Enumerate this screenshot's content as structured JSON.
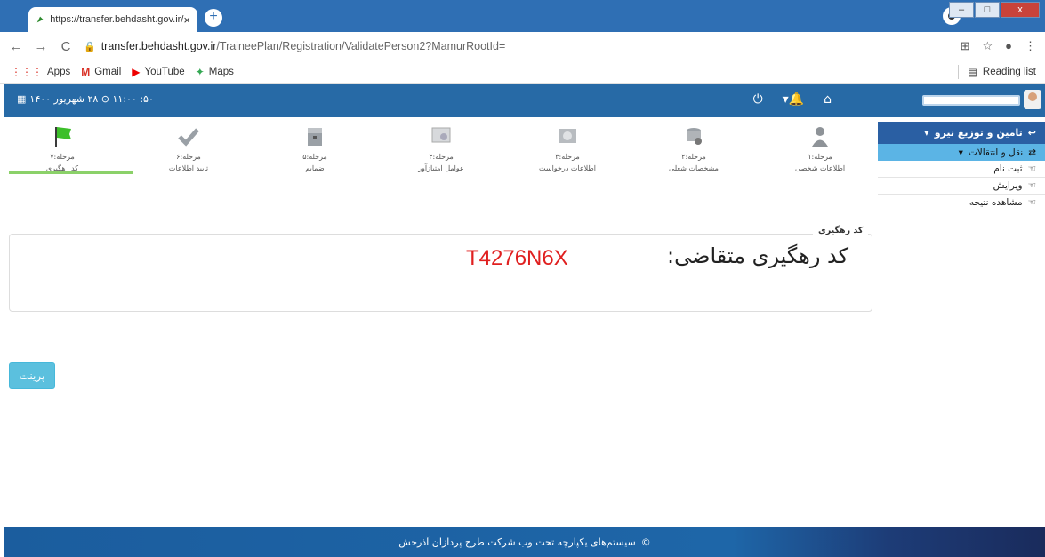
{
  "browser": {
    "tab_title": "https://transfer.behdasht.gov.ir/",
    "tab_close": "×",
    "new_tab": "+",
    "url_domain": "transfer.behdasht.gov.ir",
    "url_path": "/TraineePlan/Registration/ValidatePerson2?MamurRootId=",
    "bookmarks": [
      {
        "label": "Apps",
        "icon": "apps-grid-icon"
      },
      {
        "label": "Gmail",
        "icon": "gmail-icon"
      },
      {
        "label": "YouTube",
        "icon": "youtube-icon"
      },
      {
        "label": "Maps",
        "icon": "maps-icon"
      }
    ],
    "reading_list": "Reading list"
  },
  "header": {
    "datetime": "۵۰: ۱۱:۰۰ ⊙ ۲۸ شهریور ۱۴۰۰"
  },
  "steps": [
    {
      "number": "مرحله:۷",
      "title": "کد رهگیری",
      "icon": "green-flag-icon"
    },
    {
      "number": "مرحله:۶",
      "title": "تایید اطلاعات",
      "icon": "check-icon"
    },
    {
      "number": "مرحله:۵",
      "title": "ضمایم",
      "icon": "archive-icon"
    },
    {
      "number": "مرحله:۴",
      "title": "عوامل امتیازآور",
      "icon": "certificate-icon"
    },
    {
      "number": "مرحله:۳",
      "title": "اطلاعات درخواست",
      "icon": "request-icon"
    },
    {
      "number": "مرحله:۲",
      "title": "مشخصات شغلی",
      "icon": "job-icon"
    },
    {
      "number": "مرحله:۱",
      "title": "اطلاعات شخصی",
      "icon": "person-icon"
    }
  ],
  "tracking": {
    "legend": "کد رهگیری",
    "label": "کد رهگیری متقاضی:",
    "code": "T4276N6X"
  },
  "print_button": "پرینت",
  "right_menu": {
    "header": "تامین و توزیع نیرو",
    "sub": "نقل و انتقالات",
    "items": [
      "ثبت نام",
      "ویرایش",
      "مشاهده نتیجه"
    ]
  },
  "footer": "سیستم‌های یکپارچه تحت وب شرکت طرح پردازان آذرخش"
}
